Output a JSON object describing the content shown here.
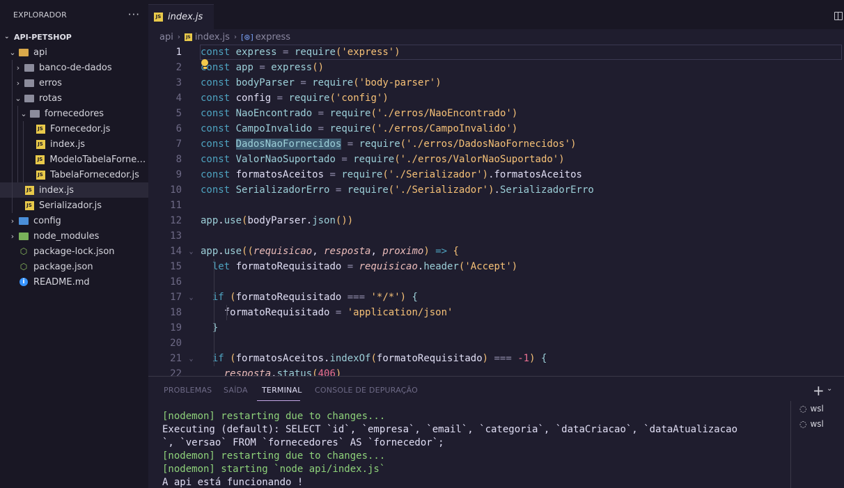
{
  "sidebar": {
    "title": "EXPLORADOR",
    "more": "···",
    "project": "API-PETSHOP",
    "tree": [
      {
        "label": "api",
        "icon": "folder-open",
        "chev": "⌄"
      },
      {
        "label": "banco-de-dados",
        "icon": "folder",
        "chev": "›"
      },
      {
        "label": "erros",
        "icon": "folder",
        "chev": "›"
      },
      {
        "label": "rotas",
        "icon": "folder",
        "chev": "⌄"
      },
      {
        "label": "fornecedores",
        "icon": "folder",
        "chev": "⌄"
      },
      {
        "label": "Fornecedor.js",
        "icon": "js"
      },
      {
        "label": "index.js",
        "icon": "js"
      },
      {
        "label": "ModeloTabelaFornec...",
        "icon": "js"
      },
      {
        "label": "TabelaFornecedor.js",
        "icon": "js"
      },
      {
        "label": "index.js",
        "icon": "js"
      },
      {
        "label": "Serializador.js",
        "icon": "js"
      },
      {
        "label": "config",
        "icon": "folder-config",
        "chev": "›"
      },
      {
        "label": "node_modules",
        "icon": "folder-node",
        "chev": "›"
      },
      {
        "label": "package-lock.json",
        "icon": "json"
      },
      {
        "label": "package.json",
        "icon": "json"
      },
      {
        "label": "README.md",
        "icon": "info"
      }
    ]
  },
  "tabs": {
    "active": "index.js",
    "js_badge": "JS"
  },
  "breadcrumb": {
    "folder": "api",
    "file": "index.js",
    "symbol": "express",
    "symbol_icon": "[⊛]"
  },
  "editor": {
    "line_numbers": [
      "1",
      "2",
      "3",
      "4",
      "5",
      "6",
      "7",
      "8",
      "9",
      "10",
      "11",
      "12",
      "13",
      "14",
      "15",
      "16",
      "17",
      "18",
      "19",
      "20",
      "21",
      "22"
    ]
  },
  "panel": {
    "tabs": [
      "PROBLEMAS",
      "SAÍDA",
      "TERMINAL",
      "CONSOLE DE DEPURAÇÃO"
    ],
    "active_tab": "TERMINAL",
    "add_icon": "+",
    "dropdown_icon": "⌄",
    "terminal_lines": [
      "[nodemon] restarting due to changes...",
      "Executing (default): SELECT `id`, `empresa`, `email`, `categoria`, `dataCriacao`, `dataAtualizacao",
      "`, `versao` FROM `fornecedores` AS `fornecedor`;",
      "[nodemon] restarting due to changes...",
      "[nodemon] starting `node api/index.js`",
      "A api está funcionando !"
    ],
    "terminals": [
      "wsl",
      "wsl"
    ]
  },
  "colors": {
    "accent": "#c4a7e7",
    "background": "#1f1d2e",
    "sidebar": "#191724"
  }
}
